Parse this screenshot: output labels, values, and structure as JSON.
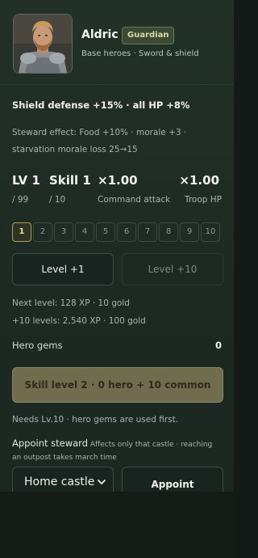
{
  "hero": {
    "name": "Aldric",
    "badge": "Guardian",
    "subtitle": "Base heroes · Sword & shield",
    "portrait_icon": "knight-portrait"
  },
  "bonus": "Shield defense +15% · all HP +8%",
  "steward_effect": "Steward effect: Food +10% · morale +3 · starvation morale loss 25→15",
  "stats": {
    "level": {
      "value": "LV 1",
      "sub": "/ 99"
    },
    "skill": {
      "value": "Skill 1",
      "sub": "/ 10"
    },
    "command": {
      "value": "×1.00",
      "sub": "Command attack"
    },
    "troop": {
      "value": "×1.00",
      "sub": "Troop HP"
    }
  },
  "skill_levels": [
    "1",
    "2",
    "3",
    "4",
    "5",
    "6",
    "7",
    "8",
    "9",
    "10"
  ],
  "selected_skill_level": "1",
  "actions": {
    "level_plus_1": "Level +1",
    "level_plus_10": "Level +10"
  },
  "next_level": "Next level: 128 XP · 10 gold",
  "ten_levels": "+10 levels: 2,540 XP · 100 gold",
  "gems": {
    "label": "Hero gems",
    "value": "0"
  },
  "skill_button": "Skill level 2 · 0 hero + 10 common",
  "needs_note": "Needs Lv.10 · hero gems are used first.",
  "appoint": {
    "title": "Appoint steward",
    "note": "Affects only that castle · reaching an outpost takes march time",
    "castle_value": "Home castle",
    "button": "Appoint"
  },
  "colors": {
    "panel": "#1e2b24",
    "accent_gold": "#b59d4a",
    "skill_button": "#6f6d4e"
  }
}
